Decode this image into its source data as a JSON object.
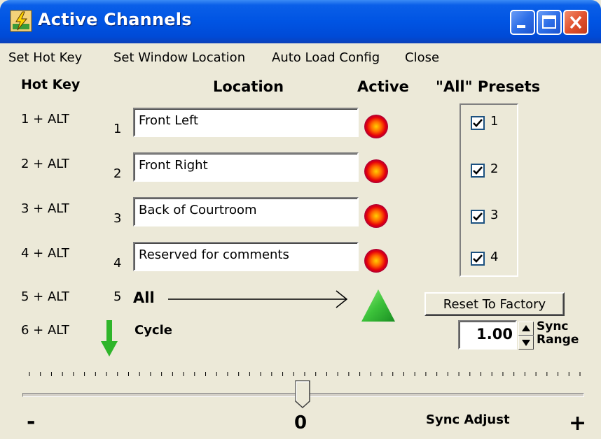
{
  "window": {
    "title": "Active Channels"
  },
  "menu": [
    "Set Hot Key",
    "Set Window Location",
    "Auto Load Config",
    "Close"
  ],
  "headers": {
    "hotkey": "Hot Key",
    "location": "Location",
    "active": "Active",
    "presets": "\"All\" Presets"
  },
  "channels": [
    {
      "hotkey": "1 + ALT",
      "number": "1",
      "location": "Front Left",
      "preset_checked": true,
      "preset_label": "1"
    },
    {
      "hotkey": "2 + ALT",
      "number": "2",
      "location": "Front Right",
      "preset_checked": true,
      "preset_label": "2"
    },
    {
      "hotkey": "3 + ALT",
      "number": "3",
      "location": "Back of Courtroom",
      "preset_checked": true,
      "preset_label": "3"
    },
    {
      "hotkey": "4 + ALT",
      "number": "4",
      "location": "Reserved for comments",
      "preset_checked": true,
      "preset_label": "4"
    }
  ],
  "all_row": {
    "hotkey": "5 + ALT",
    "number": "5",
    "label": "All"
  },
  "cycle_row": {
    "hotkey": "6 + ALT",
    "label": "Cycle"
  },
  "reset_button": "Reset To Factory",
  "sync_range": {
    "value": "1.00",
    "label_line1": "Sync",
    "label_line2": "Range"
  },
  "slider": {
    "min_label": "-",
    "center_label": "0",
    "max_label": "+",
    "caption": "Sync Adjust",
    "value": 0
  },
  "icons": {
    "app": "lightning-app-icon",
    "minimize": "minimize-icon",
    "maximize": "maximize-icon",
    "close": "close-icon",
    "active_indicator": "active-indicator-icon",
    "all_arrow": "right-arrow-icon",
    "all_active": "green-triangle-icon",
    "cycle": "green-down-arrow-icon"
  },
  "colors": {
    "title_blue": "#0054e3",
    "face": "#ece9d8",
    "active_green": "#2fb52a"
  }
}
